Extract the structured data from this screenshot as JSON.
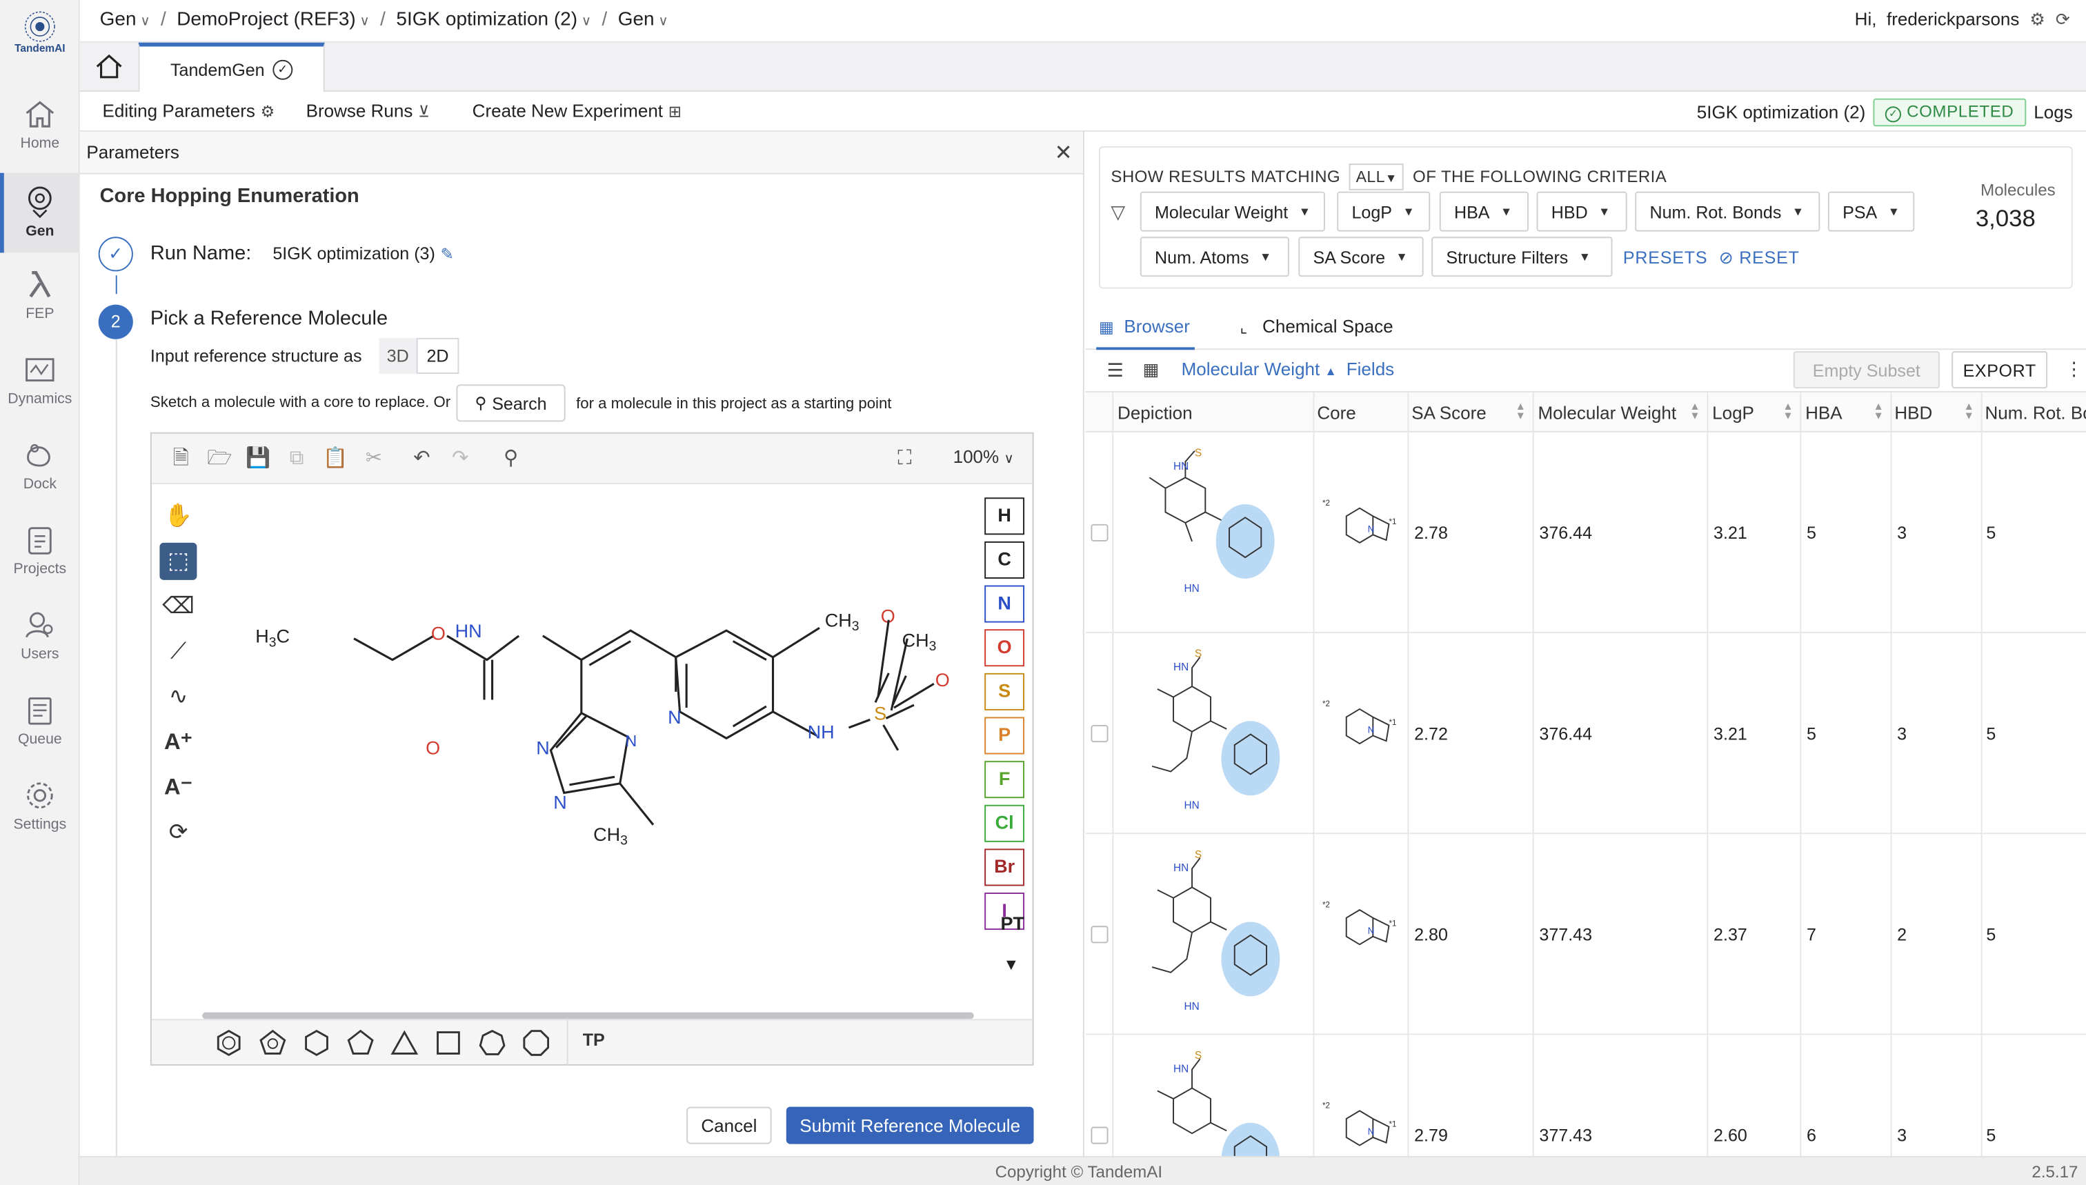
{
  "app": {
    "logo_text": "TandemAI"
  },
  "nav": [
    {
      "label": "Home",
      "icon": "home-icon"
    },
    {
      "label": "Gen",
      "icon": "gen-icon"
    },
    {
      "label": "FEP",
      "icon": "lambda-icon"
    },
    {
      "label": "Dynamics",
      "icon": "dynamics-icon"
    },
    {
      "label": "Dock",
      "icon": "dock-icon"
    },
    {
      "label": "Projects",
      "icon": "clipboard-icon"
    },
    {
      "label": "Users",
      "icon": "users-icon"
    },
    {
      "label": "Queue",
      "icon": "queue-icon"
    },
    {
      "label": "Settings",
      "icon": "gear-icon"
    }
  ],
  "breadcrumb": {
    "c1": "Gen",
    "c2": "DemoProject (REF3)",
    "c3": "5IGK optimization (2)",
    "c4": "Gen"
  },
  "user": {
    "greeting": "Hi,",
    "name": "frederickparsons"
  },
  "tabs": {
    "active": "TandemGen"
  },
  "actions": {
    "edit": "Editing Parameters",
    "browse": "Browse Runs",
    "create": "Create New Experiment"
  },
  "run": {
    "name": "5IGK optimization (2)",
    "status": "COMPLETED",
    "logs": "Logs"
  },
  "params": {
    "header": "Parameters",
    "section": "Core Hopping Enumeration",
    "step1_label": "Run Name:",
    "run_name": "5IGK optimization (3)",
    "step2_num": "2",
    "pick_title": "Pick a Reference Molecule",
    "input_as": "Input reference structure as",
    "opt3d": "3D",
    "opt2d": "2D",
    "sketch_prefix": "Sketch a molecule with a core to replace. Or",
    "search": "Search",
    "sketch_suffix": "for a molecule in this project as a starting point",
    "zoom": "100%",
    "atoms": [
      "H",
      "C",
      "N",
      "O",
      "S",
      "P",
      "F",
      "Cl",
      "Br",
      "I"
    ],
    "atom_colors": [
      "#222222",
      "#222222",
      "#2b4fc9",
      "#d23b2f",
      "#c98a12",
      "#d9822b",
      "#58a32c",
      "#3aaa3a",
      "#a3282a",
      "#8a2c9a"
    ],
    "pt": "PT",
    "tp": "TP",
    "cancel": "Cancel",
    "submit": "Submit Reference Molecule"
  },
  "results": {
    "show_matching": "SHOW RESULTS MATCHING",
    "all": "ALL",
    "criteria": "OF THE FOLLOWING CRITERIA",
    "filters": [
      "Molecular Weight",
      "LogP",
      "HBA",
      "HBD",
      "Num. Rot. Bonds",
      "PSA",
      "Num. Atoms",
      "SA Score",
      "Structure Filters"
    ],
    "presets": "PRESETS",
    "reset": "RESET",
    "molecules_label": "Molecules",
    "molecules_count": "3,038",
    "tab_browser": "Browser",
    "tab_space": "Chemical Space",
    "sort_field": "Molecular Weight",
    "fields": "Fields",
    "empty_subset": "Empty Subset",
    "export": "EXPORT",
    "columns": [
      "Depiction",
      "Core",
      "SA Score",
      "Molecular Weight",
      "LogP",
      "HBA",
      "HBD",
      "Num. Rot. Bo"
    ],
    "rows": [
      {
        "sa": "2.78",
        "mw": "376.44",
        "logp": "3.21",
        "hba": "5",
        "hbd": "3",
        "rot": "5"
      },
      {
        "sa": "2.72",
        "mw": "376.44",
        "logp": "3.21",
        "hba": "5",
        "hbd": "3",
        "rot": "5"
      },
      {
        "sa": "2.80",
        "mw": "377.43",
        "logp": "2.37",
        "hba": "7",
        "hbd": "2",
        "rot": "5"
      },
      {
        "sa": "2.79",
        "mw": "377.43",
        "logp": "2.60",
        "hba": "6",
        "hbd": "3",
        "rot": "5"
      }
    ]
  },
  "footer": {
    "copyright": "Copyright © TandemAI",
    "version": "2.5.17"
  },
  "colors": {
    "accent": "#3a6fc0",
    "success": "#2f8a45",
    "highlight": "#a9cff2"
  }
}
